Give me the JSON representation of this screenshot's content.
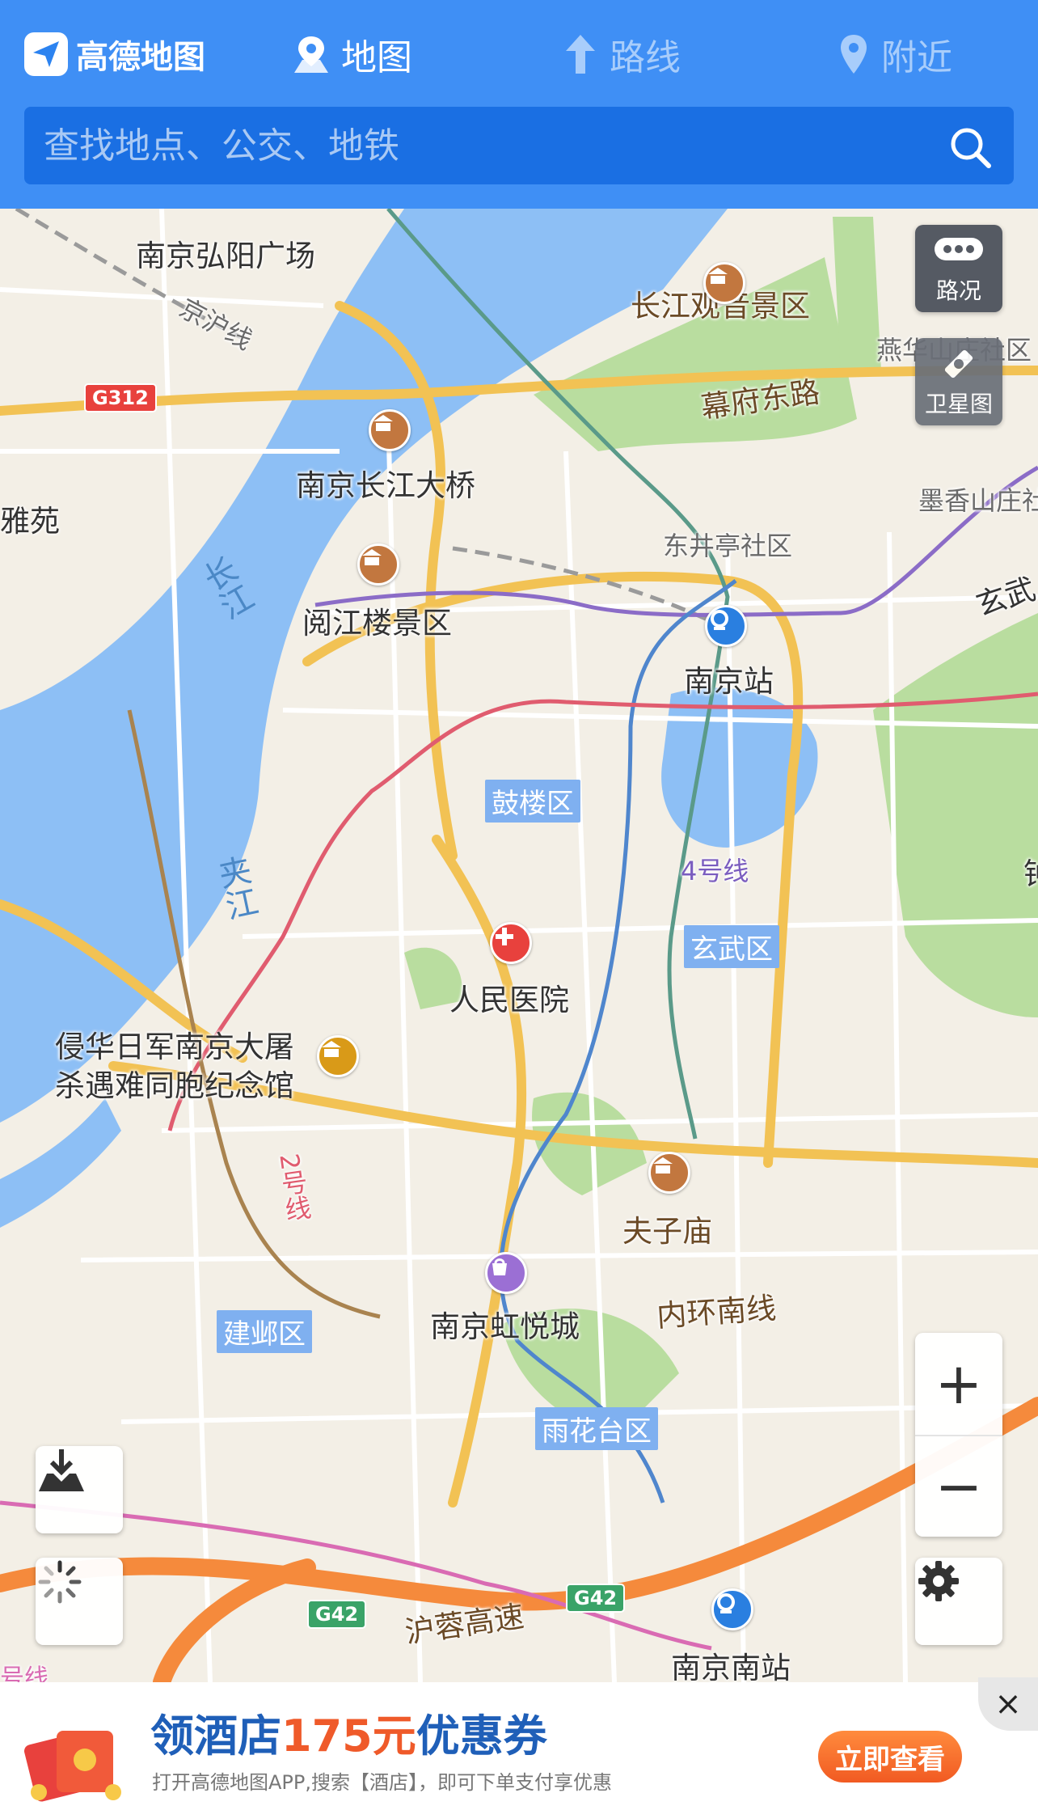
{
  "header": {
    "brand": "高德地图",
    "nav": {
      "map": "地图",
      "route": "路线",
      "nearby": "附近"
    },
    "search_placeholder": "查找地点、公交、地铁"
  },
  "map": {
    "controls": {
      "traffic": "路况",
      "satellite": "卫星图",
      "zoom_in": "+",
      "zoom_out": "−"
    },
    "labels": {
      "hongyang": "南京弘阳广场",
      "jinghu": "京沪线",
      "guanyin": "长江观音景区",
      "mufu": "幕府东路",
      "yanhua": "燕华山庄社区",
      "daqiao": "南京长江大桥",
      "yayuan": "雅苑",
      "moxiang": "墨香山庄社",
      "dongjing": "东井亭社区",
      "yuejiang": "阅江楼景区",
      "xuanwu_edge": "玄武",
      "nanjing_station": "南京站",
      "changjiang": "长江",
      "gulou": "鼓楼区",
      "jiajiang": "夹江",
      "line4": "4号线",
      "zhong": "钟",
      "xuanwu": "玄武区",
      "hospital": "人民医院",
      "memorial_1": "侵华日军南京大屠",
      "memorial_2": "杀遇难同胞纪念馆",
      "line2": "2号线",
      "fuzimiao": "夫子庙",
      "hongyue": "南京虹悦城",
      "neihuan": "内环南线",
      "jianye": "建邺区",
      "yuhua": "雨花台区",
      "hurong": "沪蓉高速",
      "south_station": "南京南站",
      "line_edge": "号线"
    },
    "shields": {
      "g312": "G312",
      "g42a": "G42",
      "g42b": "G42"
    }
  },
  "ad": {
    "title_pre": "领酒店",
    "title_amount": "175元",
    "title_post": "优惠券",
    "subtitle": "打开高德地图APP,搜索【酒店】，即可下单支付享优惠",
    "button": "立即查看",
    "close": "×"
  },
  "colors": {
    "header": "#3f8ff5",
    "river": "#8dbff5",
    "park": "#b8dc9c",
    "arterial": "#f2c254",
    "expressway": "#f58a3c"
  }
}
